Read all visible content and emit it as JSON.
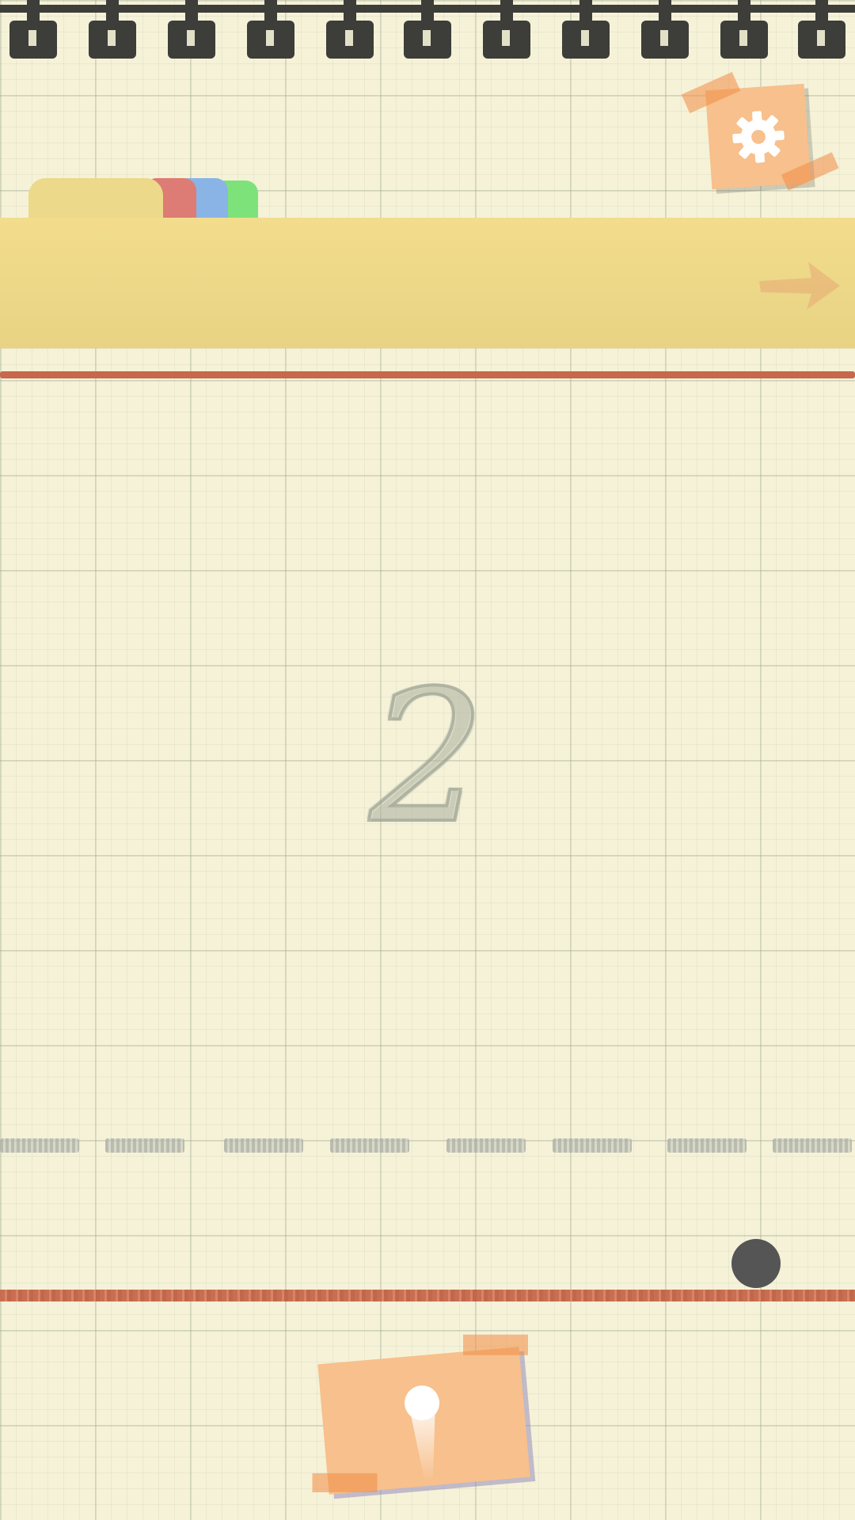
{
  "game": {
    "countdown": "2"
  },
  "icons": {
    "settings": "gear-icon",
    "next": "arrow-right-icon"
  },
  "colors": {
    "paper": "#f5f2d8",
    "banner": "#ecd989",
    "tab_red": "#dd7c74",
    "tab_blue": "#8ab4e6",
    "tab_green": "#7ee27a",
    "sticky_note": "#f7c08c",
    "boundary_line": "#c8674b",
    "ball": "#555555"
  }
}
